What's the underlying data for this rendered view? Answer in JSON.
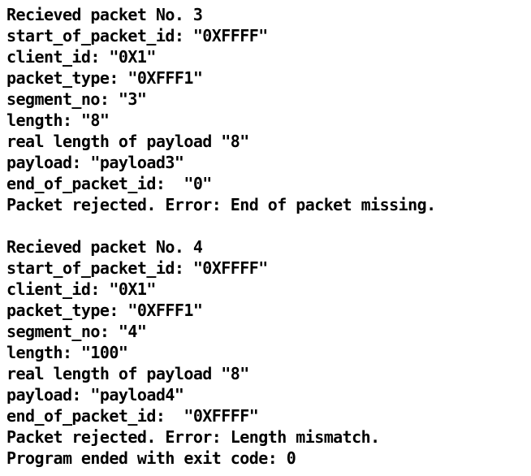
{
  "terminal_output": {
    "blocks": [
      {
        "lines": [
          "Recieved packet No. 3",
          "start_of_packet_id: \"0XFFFF\"",
          "client_id: \"0X1\"",
          "packet_type: \"0XFFF1\"",
          "segment_no: \"3\"",
          "length: \"8\"",
          "real length of payload \"8\"",
          "payload: \"payload3\"",
          "end_of_packet_id:  \"0\"",
          "Packet rejected. Error: End of packet missing."
        ]
      },
      {
        "lines": [
          "Recieved packet No. 4",
          "start_of_packet_id: \"0XFFFF\"",
          "client_id: \"0X1\"",
          "packet_type: \"0XFFF1\"",
          "segment_no: \"4\"",
          "length: \"100\"",
          "real length of payload \"8\"",
          "payload: \"payload4\"",
          "end_of_packet_id:  \"0XFFFF\"",
          "Packet rejected. Error: Length mismatch.",
          "Program ended with exit code: 0"
        ]
      }
    ]
  }
}
